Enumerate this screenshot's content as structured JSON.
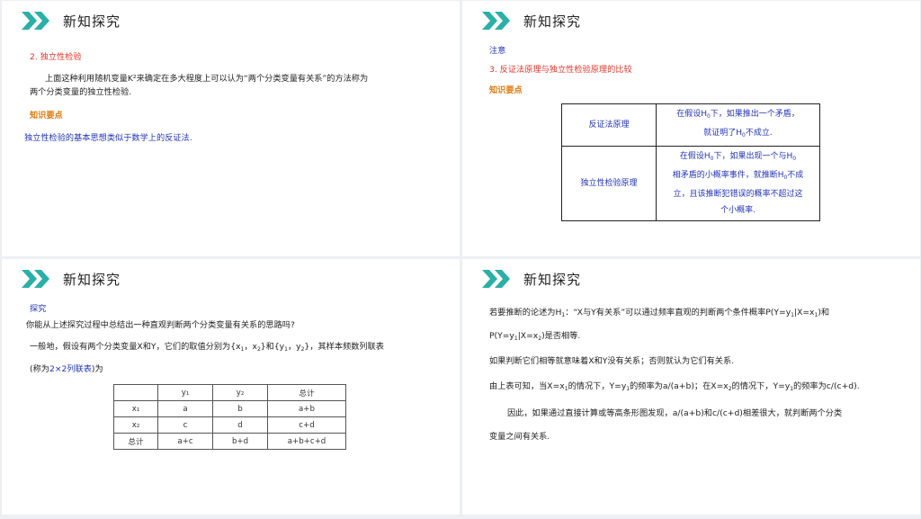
{
  "header_title": "新知探究",
  "colors": {
    "accent": "#2ab0a6",
    "red": "#e0352b",
    "orange": "#e07a10",
    "blue": "#2334b8"
  },
  "icon": "double-chevron-icon",
  "slide1": {
    "heading": "2. 独立性检验",
    "para_line1": "上面这种利用随机变量K²来确定在多大程度上可以认为“两个分类变量有关系”的方法称为",
    "para_line2": "两个分类变量的独立性检验.",
    "key_label": "知识要点",
    "key_text": "独立性检验的基本思想类似于数学上的反证法."
  },
  "slide2": {
    "note": "注意",
    "heading": "3. 反证法原理与独立性检验原理的比较",
    "key_label": "知识要点",
    "row1_key": "反证法原理",
    "row1_val_a": "在假设H",
    "row1_val_b": "下，如果推出一个矛盾，",
    "row1_val_c": "就证明了H",
    "row1_val_d": "不成立.",
    "row2_key": "独立性检验原理",
    "row2_l1a": "在假设H",
    "row2_l1b": "下，如果出现一个与H",
    "row2_l2a": "相矛盾的小概率事件，就推断H",
    "row2_l2b": "不成",
    "row2_l3": "立，且该推断犯错误的概率不超过这",
    "row2_l4": "个小概率.",
    "sub0": "0"
  },
  "slide3": {
    "label": "探究",
    "question": "你能从上述探究过程中总结出一种直观判断两个分类变量有关系的思路吗?",
    "general_a": "一般地，假设有两个分类变量X和Y，它们的取值分别为{x",
    "general_b": "，x",
    "general_c": "}和{y",
    "general_d": "，y",
    "general_e": "}，其样本频数列联表",
    "named_a": "(称为",
    "named_b": "2×2列联表",
    "named_c": ")为",
    "sub1": "1",
    "sub2": "2",
    "table": {
      "header": [
        "",
        "y₁",
        "y₂",
        "总计"
      ],
      "rows": [
        [
          "x₁",
          "a",
          "b",
          "a+b"
        ],
        [
          "x₂",
          "c",
          "d",
          "c+d"
        ],
        [
          "总计",
          "a+c",
          "b+d",
          "a+b+c+d"
        ]
      ]
    }
  },
  "slide4": {
    "p1a": "若要推断的论述为H",
    "p1b": "：“X与Y有关系”可以通过频率直观的判断两个条件概率P(Y=y",
    "p1c": "|X=x",
    "p1d": ")和",
    "p2a": "P(Y=y",
    "p2b": "|X=x",
    "p2c": ")是否相等.",
    "p3": "如果判断它们相等就意味着X和Y没有关系；否则就认为它们有关系.",
    "p4a": "由上表可知，当X=x",
    "p4b": "的情况下，Y=y",
    "p4c": "的频率为a/(a+b)；在X=x",
    "p4d": "的情况下，Y=y",
    "p4e": "的频率为c/(c+d).",
    "p5": "因此，如果通过直接计算或等高条形图发现，a/(a+b)和c/(c+d)相差很大，就判断两个分类",
    "p6": "变量之间有关系.",
    "sub1": "1",
    "sub2": "2"
  }
}
